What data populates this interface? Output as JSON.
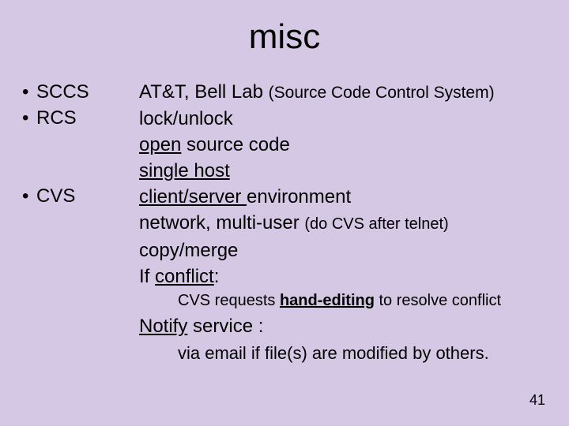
{
  "title": "misc",
  "left": {
    "items": [
      {
        "bullet": "•",
        "label": "SCCS"
      },
      {
        "bullet": "•",
        "label": "RCS"
      },
      {
        "bullet": "",
        "label": ""
      },
      {
        "bullet": "",
        "label": ""
      },
      {
        "bullet": "•",
        "label": "CVS"
      }
    ]
  },
  "right": {
    "l1a": "AT&T,  Bell Lab ",
    "l1b": "(Source Code Control System)",
    "l2": "lock/unlock",
    "l3a": "open",
    "l3b": " source code",
    "l4": "single host",
    "l5a": "client/server ",
    "l5b": "environment",
    "l6a": "network, multi-user ",
    "l6b": "(do CVS after telnet)",
    "l7": "copy/merge",
    "l8a": "If ",
    "l8b": "conflict",
    "l8c": ":"
  },
  "cvsnote": {
    "a": "CVS requests ",
    "b": "hand-editing",
    "c": " to resolve conflict"
  },
  "notify": {
    "a": "Notify",
    "b": " service :",
    "sub": "via email if file(s) are modified by others."
  },
  "pagenum": "41"
}
